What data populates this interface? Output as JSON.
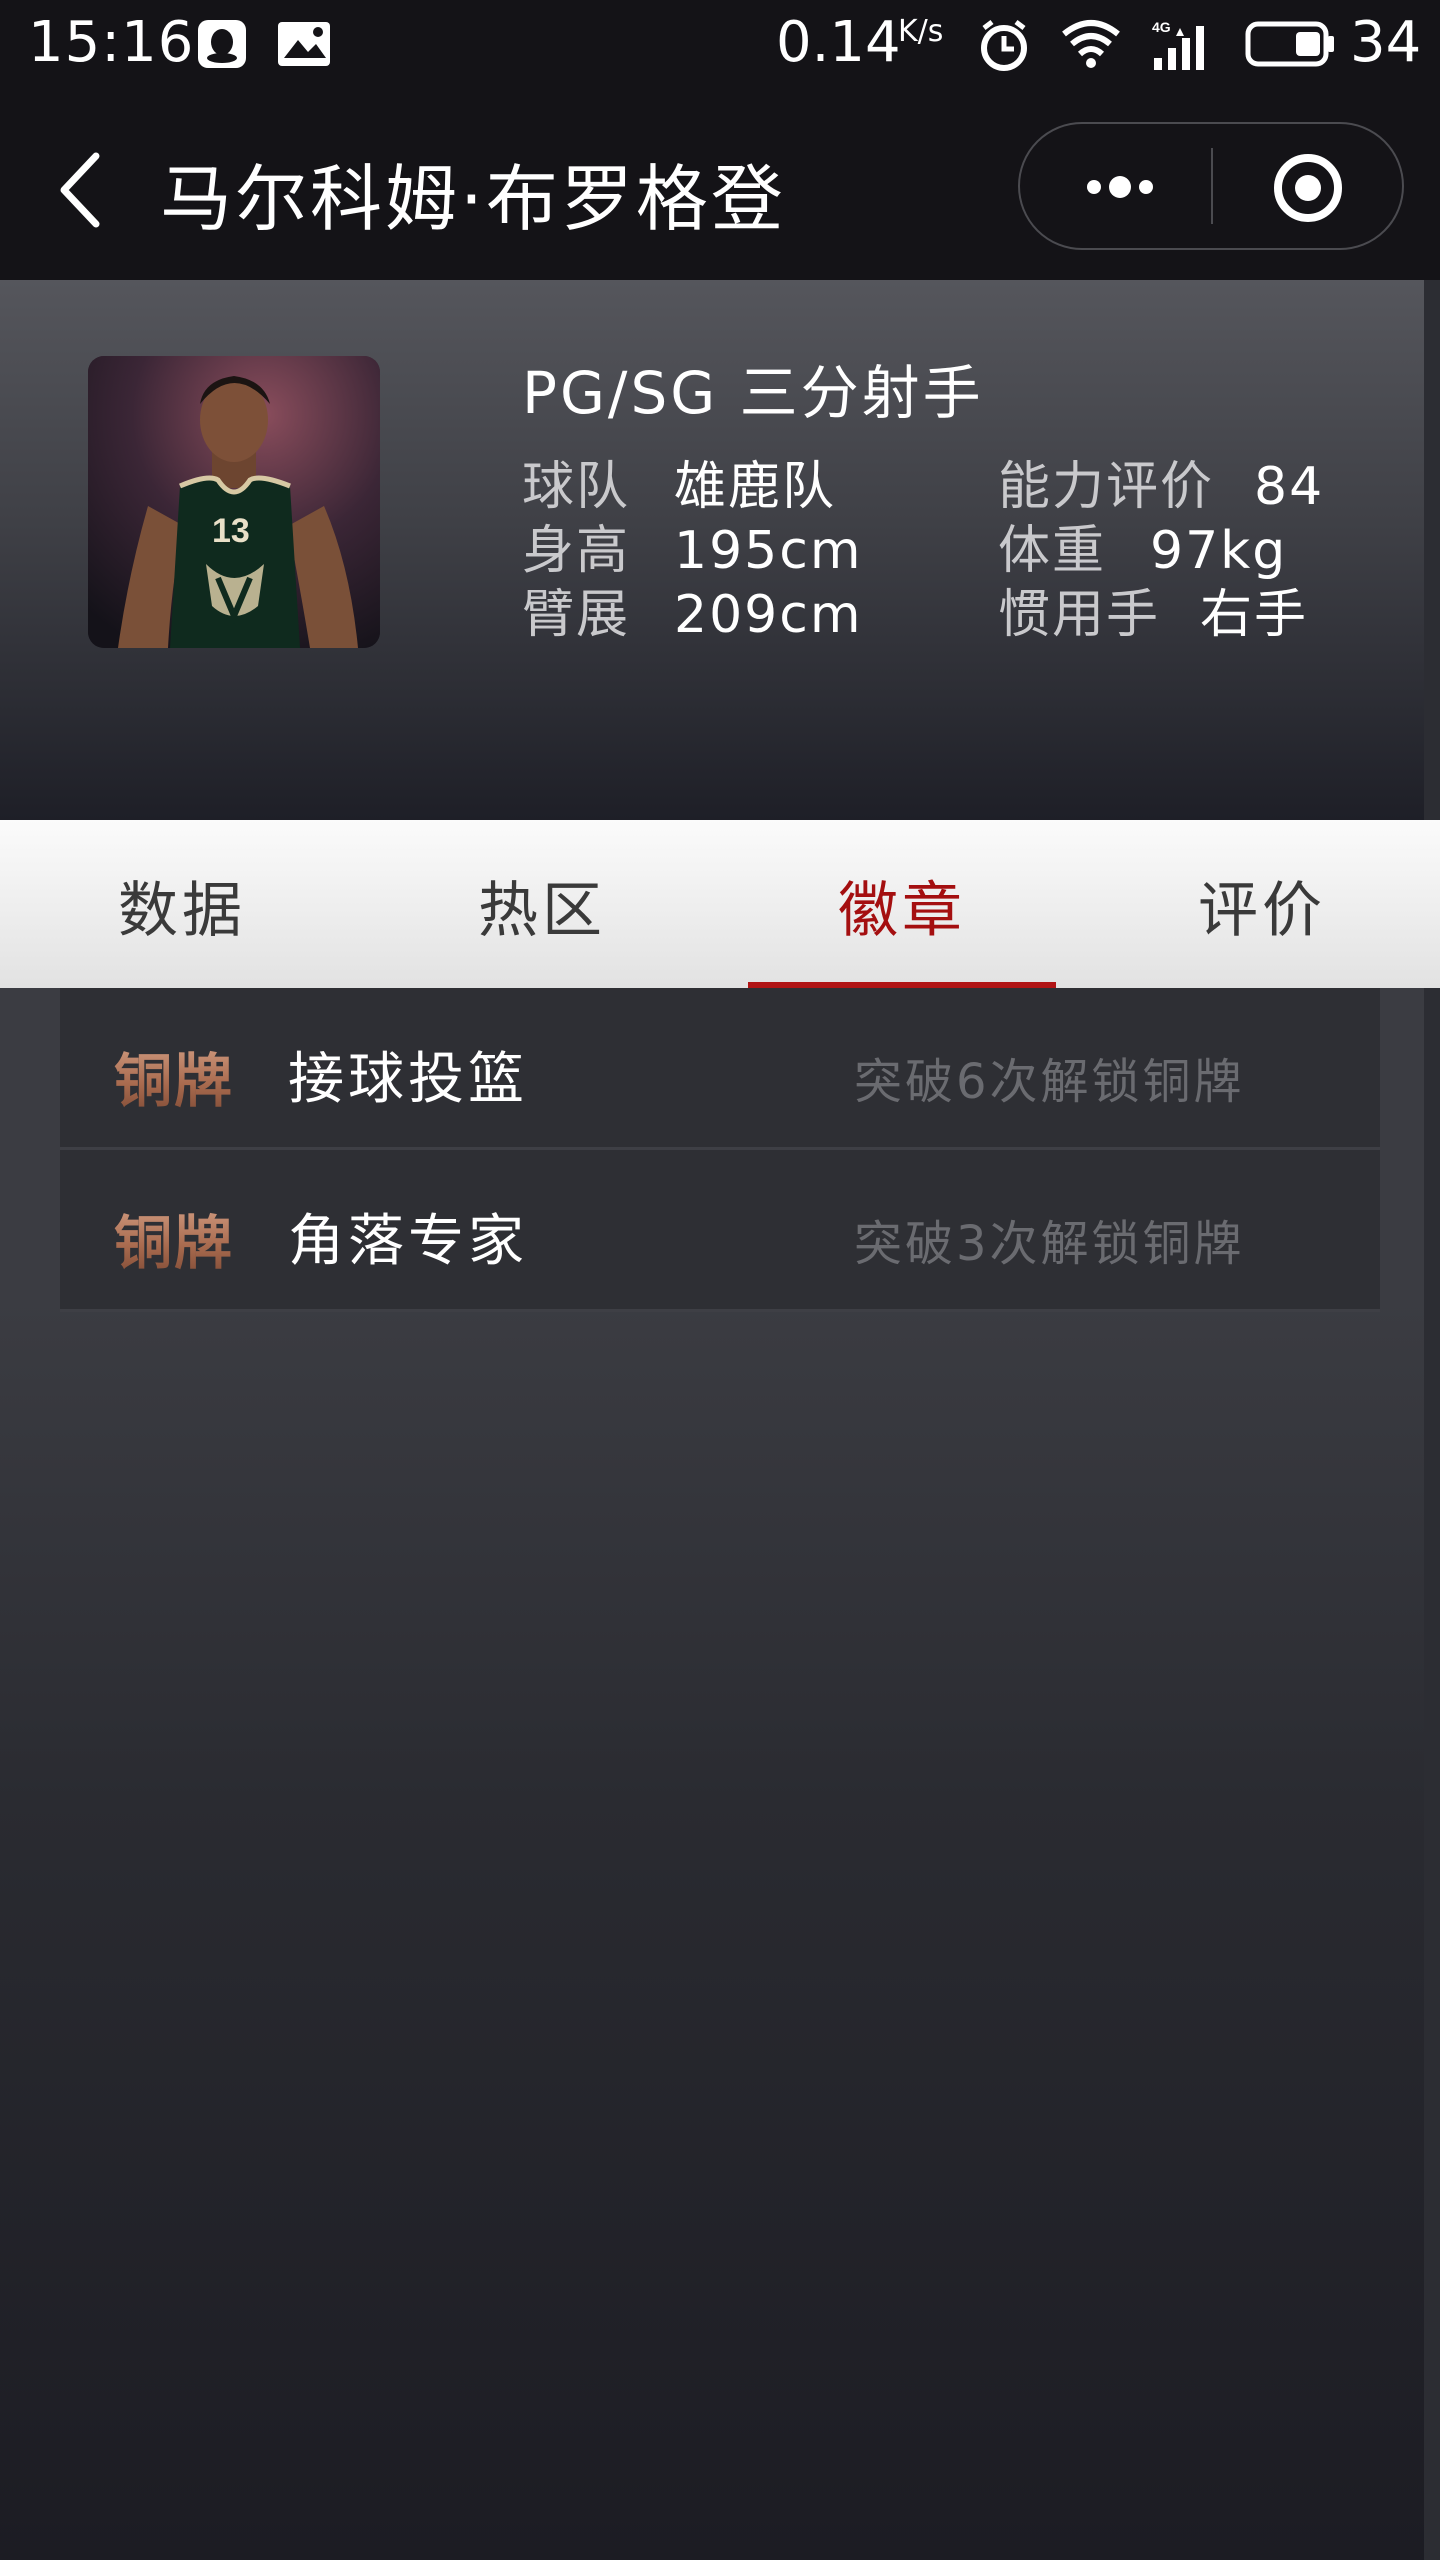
{
  "status_bar": {
    "time": "15:16",
    "speed": "0.14",
    "speed_unit": "K/s",
    "battery": "34",
    "icons": [
      "qq-icon",
      "gallery-icon",
      "alarm-icon",
      "wifi-icon",
      "signal-4g-icon",
      "battery-icon"
    ]
  },
  "nav": {
    "title": "马尔科姆·布罗格登",
    "back_icon": "chevron-left-icon",
    "more_icon": "more-dots-icon",
    "close_icon": "target-close-icon"
  },
  "player": {
    "position_line": "PG/SG 三分射手",
    "team_label": "球队",
    "team_value": "雄鹿队",
    "rating_label": "能力评价",
    "rating_value": "84",
    "height_label": "身高",
    "height_value": "195cm",
    "weight_label": "体重",
    "weight_value": "97kg",
    "wingspan_label": "臂展",
    "wingspan_value": "209cm",
    "hand_label": "惯用手",
    "hand_value": "右手",
    "jersey_number": "13"
  },
  "tabs": [
    {
      "label": "数据",
      "active": false
    },
    {
      "label": "热区",
      "active": false
    },
    {
      "label": "徽章",
      "active": true
    },
    {
      "label": "评价",
      "active": false
    }
  ],
  "badges": [
    {
      "level": "铜牌",
      "name": "接球投篮",
      "hint": "突破6次解锁铜牌"
    },
    {
      "level": "铜牌",
      "name": "角落专家",
      "hint": "突破3次解锁铜牌"
    }
  ],
  "colors": {
    "active_tab": "#a40f10",
    "rating": "#f4c21d",
    "bronze": "#c08a6f"
  }
}
